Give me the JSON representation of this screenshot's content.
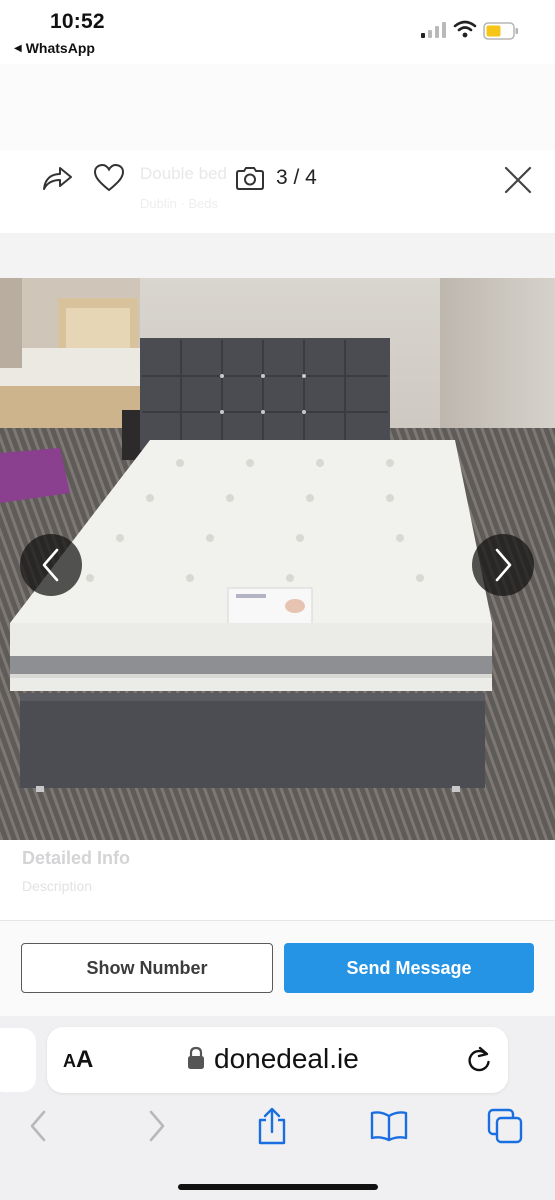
{
  "status_bar": {
    "time": "10:52",
    "back_app": "WhatsApp",
    "back_arrow": "◀"
  },
  "gallery": {
    "counter": "3 / 4",
    "ghost_title": "Double bed",
    "ghost_subtitle": "Dublin · Beds",
    "icons": [
      "share-icon",
      "heart-icon",
      "camera-icon",
      "close-icon",
      "chevron-left-icon",
      "chevron-right-icon"
    ]
  },
  "listing": {
    "detailed_info": "Detailed Info",
    "description": "Description"
  },
  "actions": {
    "show_number": "Show Number",
    "send_message": "Send Message",
    "send_color": "#2694e5"
  },
  "browser": {
    "aa_large": "A",
    "aa_small": "A",
    "url": "donedeal.ie",
    "toolbar": [
      "back-icon",
      "forward-icon",
      "share-icon",
      "bookmarks-icon",
      "tabs-icon"
    ],
    "accent": "#1a6fe0"
  }
}
